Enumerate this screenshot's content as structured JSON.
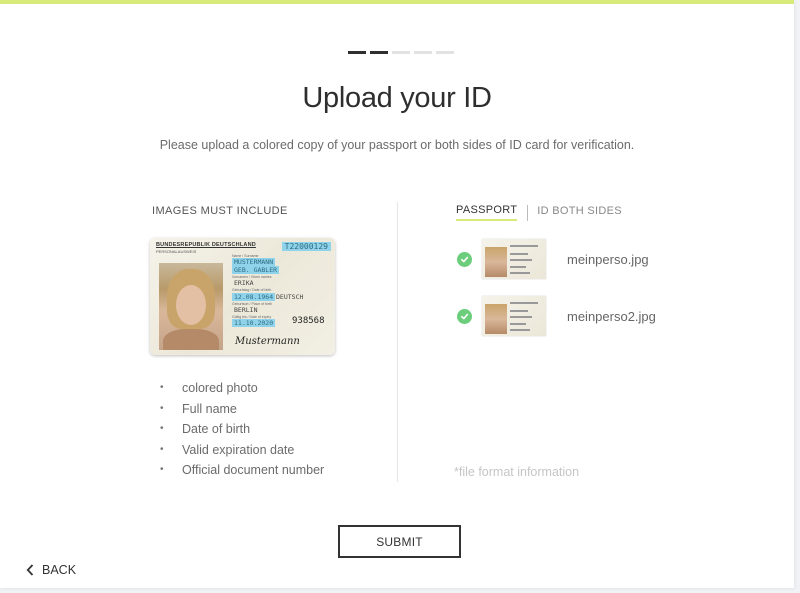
{
  "progress": {
    "total_steps": 5,
    "current_step": 2
  },
  "header": {
    "title": "Upload your ID",
    "subtitle": "Please upload a colored copy of your passport or both sides of ID card for verification."
  },
  "requirements": {
    "heading": "IMAGES MUST INCLUDE",
    "sample_card": {
      "country_header": "BUNDESREPUBLIK DEUTSCHLAND",
      "doc_type": "PERSONALAUSWEIS",
      "card_number": "T22000129",
      "surname": "MUSTERMANN",
      "birth_name": "GEB. GABLER",
      "given_name": "ERIKA",
      "date_of_birth": "12.08.1964",
      "nationality": "DEUTSCH",
      "place_of_birth": "BERLIN",
      "expiry_date": "11.10.2020",
      "access_number": "938568",
      "signature": "Mustermann"
    },
    "items": [
      "colored photo",
      "Full name",
      "Date of birth",
      "Valid expiration date",
      "Official document number"
    ]
  },
  "upload": {
    "tabs": [
      {
        "label": "PASSPORT",
        "active": true
      },
      {
        "label": "ID BOTH SIDES",
        "active": false
      }
    ],
    "files": [
      {
        "name": "meinperso.jpg",
        "status": "uploaded",
        "icon": "check-circle-icon"
      },
      {
        "name": "meinperso2.jpg",
        "status": "uploaded",
        "icon": "check-circle-icon"
      }
    ],
    "file_info": "*file format information"
  },
  "actions": {
    "submit_label": "SUBMIT",
    "back_label": "BACK",
    "back_icon": "chevron-left-icon"
  },
  "colors": {
    "accent": "#d8ea7a",
    "success": "#6cce7d",
    "highlight": "#8ed3ea",
    "text_dark": "#2e2e2e"
  }
}
